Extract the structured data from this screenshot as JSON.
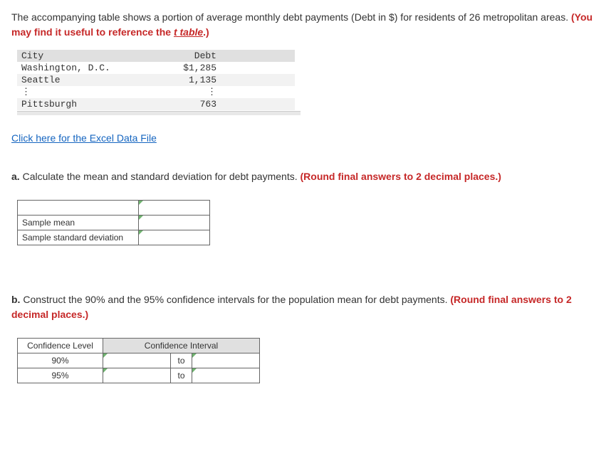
{
  "intro": {
    "text1": "The accompanying table shows a portion of average monthly debt payments (Debt in $) for residents of 26 metropolitan areas. ",
    "hint_prefix": "(You may find it useful to reference the ",
    "t_table": "t table",
    "hint_suffix": ".)"
  },
  "data_table": {
    "headers": {
      "city": "City",
      "debt": "Debt"
    },
    "rows": [
      {
        "city": "Washington, D.C.",
        "debt": "$1,285"
      },
      {
        "city": "Seattle",
        "debt": "1,135"
      },
      {
        "city": "⋮",
        "debt": "⋮"
      },
      {
        "city": "Pittsburgh",
        "debt": "763"
      }
    ]
  },
  "excel_link": "Click here for the Excel Data File",
  "part_a": {
    "label": "a.",
    "text": " Calculate the mean and standard deviation for debt payments. ",
    "note": "(Round final answers to 2 decimal places.)",
    "rows": {
      "mean": "Sample mean",
      "sd": "Sample standard deviation"
    }
  },
  "part_b": {
    "label": "b.",
    "text": " Construct the 90% and the 95% confidence intervals for the population mean for debt payments. ",
    "note": "(Round final answers to 2 decimal places.)",
    "headers": {
      "level": "Confidence Level",
      "interval": "Confidence Interval"
    },
    "rows": [
      {
        "level": "90%",
        "to": "to"
      },
      {
        "level": "95%",
        "to": "to"
      }
    ]
  }
}
